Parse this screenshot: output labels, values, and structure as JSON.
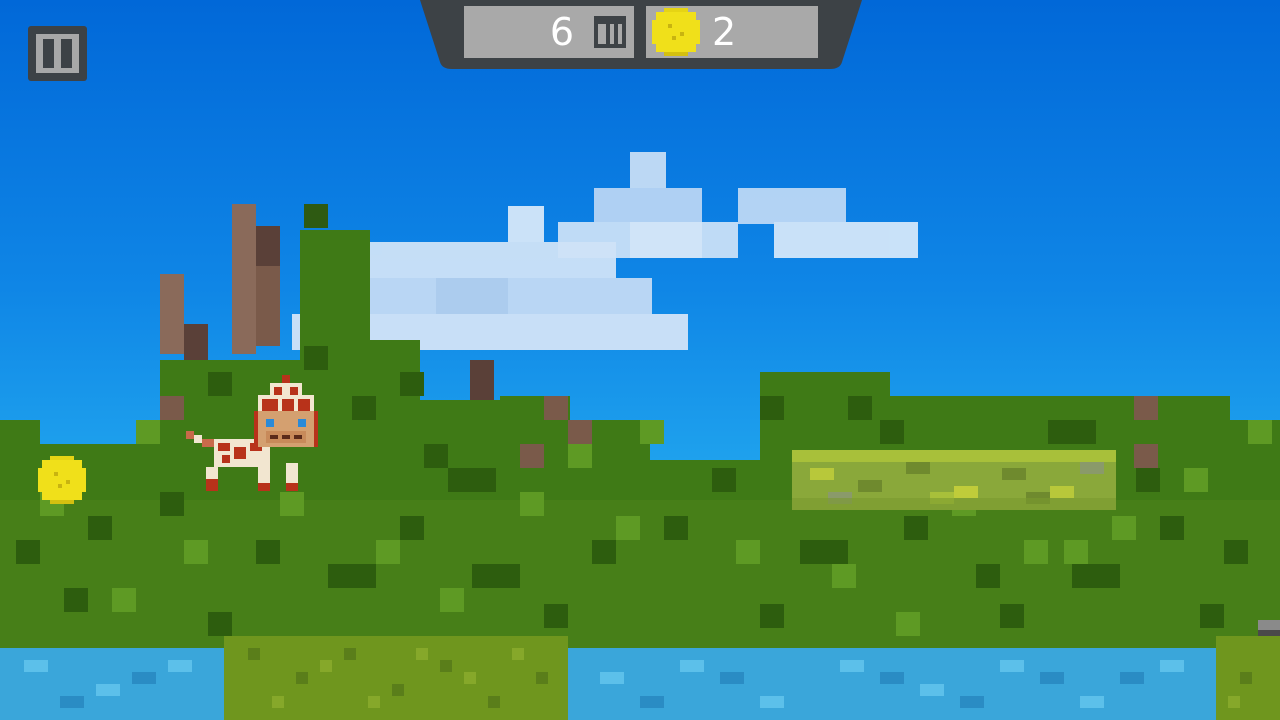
{
  "hud": {
    "distance": "6",
    "distance_unit_icon": "meter-m-icon",
    "coins": "2",
    "coin_icon": "gold-coin-icon"
  },
  "pause_button": {
    "icon": "pause-icon"
  },
  "world": {
    "player": "pixel-cat-giraffe-pattern",
    "pickups": [
      "gold-coin"
    ],
    "platform": "mossy-green-block-platform",
    "hazard": "water"
  },
  "colors": {
    "sky_top": "#0168d8",
    "sky_bottom": "#2cb4f0",
    "grass_dark": "#2f6a10",
    "grass_mid": "#4f8a1c",
    "water": "#38a6d8",
    "coin": "#f0e01a",
    "hud_bg": "#3d4246",
    "hud_panel": "#a9a9a9"
  }
}
